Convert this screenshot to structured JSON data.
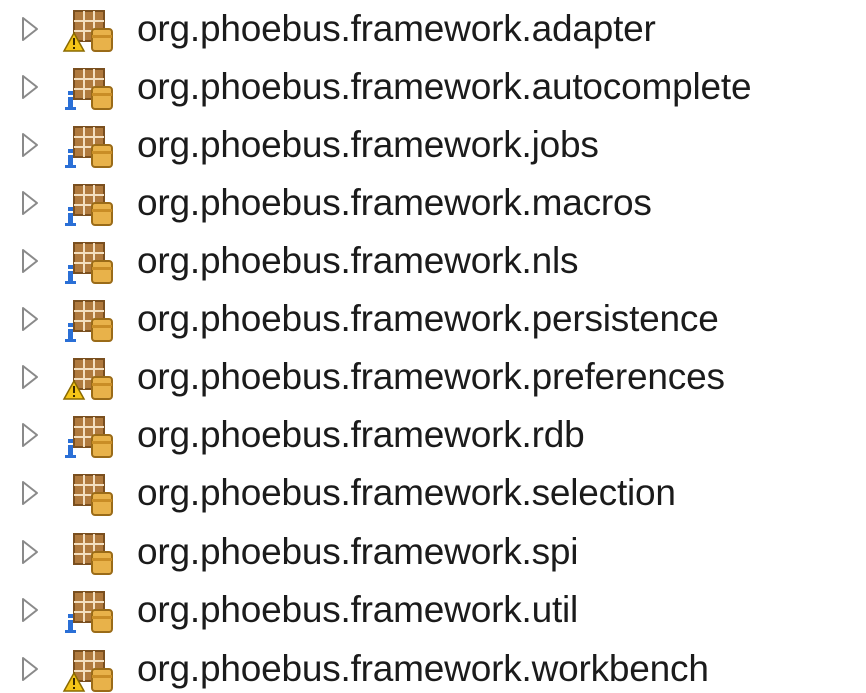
{
  "tree": {
    "items": [
      {
        "label": "org.phoebus.framework.adapter",
        "decorator": "warning",
        "icon": "package-icon"
      },
      {
        "label": "org.phoebus.framework.autocomplete",
        "decorator": "info",
        "icon": "package-icon"
      },
      {
        "label": "org.phoebus.framework.jobs",
        "decorator": "info",
        "icon": "package-icon"
      },
      {
        "label": "org.phoebus.framework.macros",
        "decorator": "info",
        "icon": "package-icon"
      },
      {
        "label": "org.phoebus.framework.nls",
        "decorator": "info",
        "icon": "package-icon"
      },
      {
        "label": "org.phoebus.framework.persistence",
        "decorator": "info",
        "icon": "package-icon"
      },
      {
        "label": "org.phoebus.framework.preferences",
        "decorator": "warning",
        "icon": "package-icon"
      },
      {
        "label": "org.phoebus.framework.rdb",
        "decorator": "info",
        "icon": "package-icon"
      },
      {
        "label": "org.phoebus.framework.selection",
        "decorator": "none",
        "icon": "package-icon"
      },
      {
        "label": "org.phoebus.framework.spi",
        "decorator": "none",
        "icon": "package-icon"
      },
      {
        "label": "org.phoebus.framework.util",
        "decorator": "info",
        "icon": "package-icon"
      },
      {
        "label": "org.phoebus.framework.workbench",
        "decorator": "warning",
        "icon": "package-icon"
      }
    ]
  },
  "colors": {
    "package_brown": "#b07a3e",
    "package_dark": "#7a4f1f",
    "jar_gold": "#e8b24a",
    "warning_yellow": "#f5c518",
    "info_blue": "#2a6fd6",
    "twisty_gray": "#8a8a8a",
    "text": "#1b1b1b"
  }
}
